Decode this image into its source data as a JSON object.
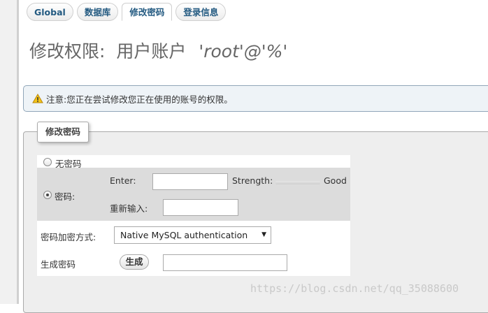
{
  "tabs": [
    {
      "label": "Global"
    },
    {
      "label": "数据库"
    },
    {
      "label": "修改密码"
    },
    {
      "label": "登录信息"
    }
  ],
  "page_title": {
    "prefix": "修改权限:",
    "account_label": "用户账户",
    "user": "'root'@'%'"
  },
  "notice": {
    "text": "注意:您正在尝试修改您正在使用的账号的权限。",
    "icon": "warning-icon"
  },
  "change_password": {
    "legend": "修改密码",
    "no_password_label": "无密码",
    "password_label": "密码:",
    "enter_label": "Enter:",
    "enter_value": "",
    "strength_label": "Strength:",
    "strength_value": "Good",
    "reenter_label": "重新输入:",
    "reenter_value": "",
    "hashing_label": "密码加密方式:",
    "hashing_selected": "Native MySQL authentication",
    "generate_label": "生成密码",
    "generate_button": "生成",
    "generated_value": ""
  },
  "watermark": "https://blog.csdn.net/qq_35088600",
  "colors": {
    "tab_text": "#235a81",
    "notice_bg": "#eef3f7",
    "notice_border": "#90a6b9",
    "warning": "#e6a000"
  }
}
